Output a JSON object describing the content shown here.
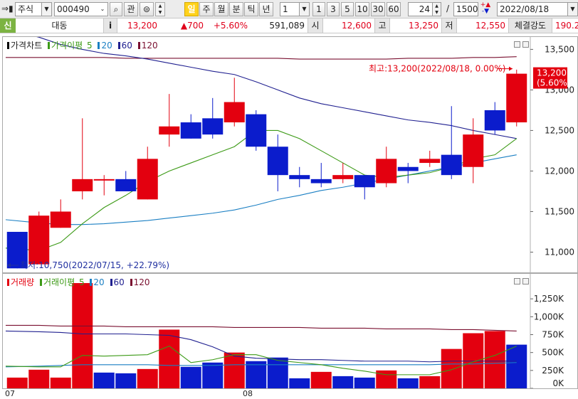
{
  "toolbar": {
    "market_type": "주식",
    "stock_code": "000490",
    "favorites_label": "관",
    "periods": [
      "일",
      "주",
      "월",
      "분",
      "틱",
      "년"
    ],
    "selected_period": "일",
    "interval_value": "1",
    "intervals": [
      "1",
      "3",
      "5",
      "10",
      "30",
      "60"
    ],
    "count_value": "24",
    "count_separator": "/",
    "count_total": "1500",
    "date_value": "2022/08/18"
  },
  "quote": {
    "badge": "신",
    "name": "대동",
    "info_label": "i",
    "price": "13,200",
    "change": "▲700",
    "change_pct": "+5.60%",
    "volume": "591,089",
    "open_label": "시",
    "open": "12,600",
    "high_label": "고",
    "high": "13,250",
    "low_label": "저",
    "low": "12,550",
    "strength_label": "체결강도",
    "strength": "190.2"
  },
  "price_panel": {
    "legend_title": "가격차트",
    "legend_ma_label": "가격이평",
    "ma_periods": [
      "5",
      "20",
      "60",
      "120"
    ],
    "max_annotation": "최고:13,200(2022/08/18, 0.00%)",
    "min_annotation": "최저:10,750(2022/07/15, +22.79%)",
    "last_price_tag": "13,200",
    "last_pct_tag": "(5.60%)"
  },
  "volume_panel": {
    "legend_title": "거래량",
    "legend_ma_label": "거래이평",
    "ma_periods": [
      "5",
      "20",
      "60",
      "120"
    ]
  },
  "x_labels": [
    "07",
    "08"
  ],
  "colors": {
    "up": "#e3000f",
    "down": "#0b1ccc",
    "ma5": "#3c9a16",
    "ma20": "#1a7fc3",
    "ma60": "#202090",
    "ma120": "#7a1030",
    "selected_period": "#ffd21c"
  },
  "chart_data": [
    {
      "type": "candlestick",
      "title": "가격차트",
      "y_ticks": [
        11000,
        11500,
        12000,
        12500,
        13000,
        13500
      ],
      "y_tick_labels": [
        "11,000",
        "11,500",
        "12,000",
        "12,500",
        "13,000",
        "13,500"
      ],
      "ylim": [
        10750,
        13600
      ],
      "candles": [
        {
          "o": 11250,
          "h": 11250,
          "l": 10800,
          "c": 10800
        },
        {
          "o": 10850,
          "h": 11500,
          "l": 10850,
          "c": 11450
        },
        {
          "o": 11300,
          "h": 11650,
          "l": 11300,
          "c": 11500
        },
        {
          "o": 11750,
          "h": 12650,
          "l": 11650,
          "c": 11900
        },
        {
          "o": 11900,
          "h": 11950,
          "l": 11700,
          "c": 11900
        },
        {
          "o": 11900,
          "h": 12000,
          "l": 11750,
          "c": 11750
        },
        {
          "o": 11650,
          "h": 12300,
          "l": 11650,
          "c": 12150
        },
        {
          "o": 12450,
          "h": 12950,
          "l": 12300,
          "c": 12550
        },
        {
          "o": 12600,
          "h": 12700,
          "l": 12400,
          "c": 12400
        },
        {
          "o": 12650,
          "h": 12900,
          "l": 12400,
          "c": 12450
        },
        {
          "o": 12600,
          "h": 13150,
          "l": 12550,
          "c": 12850
        },
        {
          "o": 12700,
          "h": 12750,
          "l": 12250,
          "c": 12300
        },
        {
          "o": 12300,
          "h": 12450,
          "l": 11750,
          "c": 11950
        },
        {
          "o": 11950,
          "h": 12050,
          "l": 11800,
          "c": 11900
        },
        {
          "o": 11900,
          "h": 12100,
          "l": 11800,
          "c": 11850
        },
        {
          "o": 11900,
          "h": 12100,
          "l": 11850,
          "c": 11950
        },
        {
          "o": 11950,
          "h": 11950,
          "l": 11650,
          "c": 11800
        },
        {
          "o": 11850,
          "h": 12300,
          "l": 11800,
          "c": 12150
        },
        {
          "o": 12050,
          "h": 12100,
          "l": 11850,
          "c": 12000
        },
        {
          "o": 12100,
          "h": 12250,
          "l": 12050,
          "c": 12150
        },
        {
          "o": 12200,
          "h": 12800,
          "l": 11900,
          "c": 11950
        },
        {
          "o": 12050,
          "h": 12650,
          "l": 11850,
          "c": 12450
        },
        {
          "o": 12750,
          "h": 12850,
          "l": 12450,
          "c": 12500
        },
        {
          "o": 12600,
          "h": 13250,
          "l": 12550,
          "c": 13200
        }
      ],
      "ma5": [
        11050,
        11020,
        11120,
        11350,
        11550,
        11700,
        11870,
        12000,
        12100,
        12200,
        12300,
        12500,
        12500,
        12400,
        12250,
        12100,
        11950,
        11920,
        11950,
        11980,
        12050,
        12150,
        12200,
        12400
      ],
      "ma20": [
        11400,
        11360,
        11340,
        11340,
        11350,
        11370,
        11390,
        11420,
        11450,
        11480,
        11520,
        11580,
        11650,
        11700,
        11760,
        11800,
        11850,
        11900,
        11950,
        12000,
        12050,
        12100,
        12150,
        12200
      ],
      "ma60": [
        13750,
        13650,
        13560,
        13500,
        13450,
        13420,
        13380,
        13330,
        13280,
        13230,
        13190,
        13100,
        13000,
        12900,
        12830,
        12780,
        12730,
        12680,
        12630,
        12600,
        12560,
        12500,
        12450,
        12400
      ],
      "ma120": [
        13400,
        13400,
        13400,
        13400,
        13400,
        13390,
        13390,
        13390,
        13390,
        13390,
        13390,
        13390,
        13390,
        13380,
        13380,
        13380,
        13380,
        13380,
        13390,
        13390,
        13390,
        13400,
        13400,
        13410
      ],
      "max": {
        "value": 13200,
        "date": "2022/08/18"
      },
      "min": {
        "value": 10750,
        "date": "2022/07/15"
      }
    },
    {
      "type": "bar",
      "title": "거래량",
      "y_ticks": [
        0,
        250000,
        500000,
        750000,
        1000000,
        1250000
      ],
      "y_tick_labels": [
        "0K",
        "250K",
        "500K",
        "750K",
        "1,000K",
        "1,250K"
      ],
      "ylim": [
        0,
        1500000
      ],
      "values": [
        150000,
        260000,
        150000,
        1470000,
        220000,
        210000,
        270000,
        820000,
        300000,
        360000,
        500000,
        380000,
        430000,
        140000,
        230000,
        170000,
        150000,
        250000,
        140000,
        170000,
        550000,
        770000,
        800000,
        610000
      ],
      "up": [
        true,
        true,
        true,
        true,
        false,
        false,
        true,
        true,
        false,
        false,
        true,
        false,
        false,
        false,
        true,
        false,
        false,
        true,
        false,
        true,
        true,
        true,
        true,
        false
      ],
      "ma5": [
        310000,
        300000,
        300000,
        460000,
        450000,
        460000,
        470000,
        590000,
        360000,
        400000,
        470000,
        470000,
        390000,
        360000,
        330000,
        280000,
        240000,
        190000,
        190000,
        190000,
        260000,
        370000,
        460000,
        590000
      ],
      "ma20": [
        800000,
        790000,
        780000,
        760000,
        760000,
        760000,
        750000,
        740000,
        680000,
        580000,
        450000,
        420000,
        410000,
        400000,
        400000,
        390000,
        380000,
        380000,
        380000,
        370000,
        380000,
        380000,
        380000,
        380000
      ],
      "ma60": [
        300000,
        310000,
        320000,
        330000,
        330000,
        330000,
        330000,
        320000,
        320000,
        320000,
        330000,
        330000,
        330000,
        330000,
        330000,
        330000,
        330000,
        330000,
        330000,
        330000,
        340000,
        340000,
        350000,
        360000
      ],
      "ma120": [
        880000,
        880000,
        870000,
        870000,
        870000,
        860000,
        860000,
        860000,
        860000,
        860000,
        850000,
        850000,
        850000,
        850000,
        840000,
        840000,
        840000,
        830000,
        830000,
        830000,
        820000,
        820000,
        810000,
        800000
      ]
    }
  ]
}
